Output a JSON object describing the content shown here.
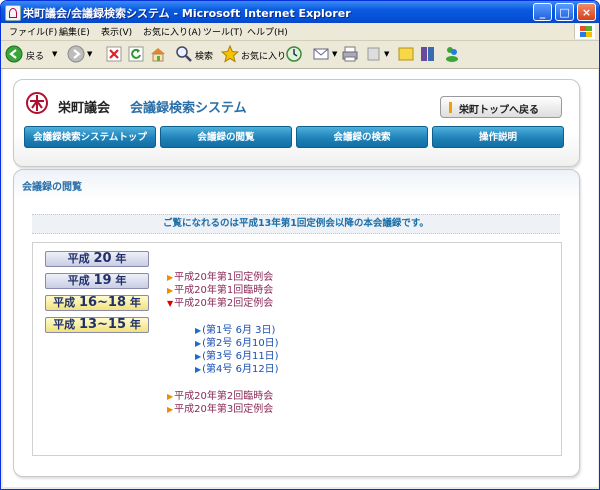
{
  "window": {
    "title": "栄町議会/会議録検索システム - Microsoft Internet Explorer",
    "controls": {
      "minimize": "_",
      "maximize": "□",
      "close": "×"
    }
  },
  "menu": [
    "ファイル(F)",
    "編集(E)",
    "表示(V)",
    "お気に入り(A)",
    "ツール(T)",
    "ヘルプ(H)"
  ],
  "toolbar": {
    "back_label": "戻る",
    "search_label": "検索",
    "favorites_label": "お気に入り"
  },
  "header": {
    "site_name": "栄町議会",
    "system_name": "会議録検索システム",
    "back_button": "栄町トップへ戻る",
    "nav": [
      "会議録検索システムトップ",
      "会議録の閲覧",
      "会議録の検索",
      "操作説明"
    ]
  },
  "main": {
    "section_title": "会議録の閲覧",
    "notice": "ご覧になれるのは平成13年第1回定例会以降の本会議録です。",
    "years": [
      {
        "prefix": "平成",
        "num": "20",
        "suffix": "年"
      },
      {
        "prefix": "平成",
        "num": "19",
        "suffix": "年"
      },
      {
        "prefix": "平成",
        "num": "16~18",
        "suffix": "年"
      },
      {
        "prefix": "平成",
        "num": "13~15",
        "suffix": "年"
      }
    ],
    "sessions": [
      "平成20年第1回定例会",
      "平成20年第1回臨時会",
      "平成20年第2回定例会"
    ],
    "sub_items": [
      "(第1号 6月 3日)",
      "(第2号 6月10日)",
      "(第3号 6月11日)",
      "(第4号 6月12日)"
    ],
    "sessions_after": [
      "平成20年第2回臨時会",
      "平成20年第3回定例会"
    ]
  }
}
